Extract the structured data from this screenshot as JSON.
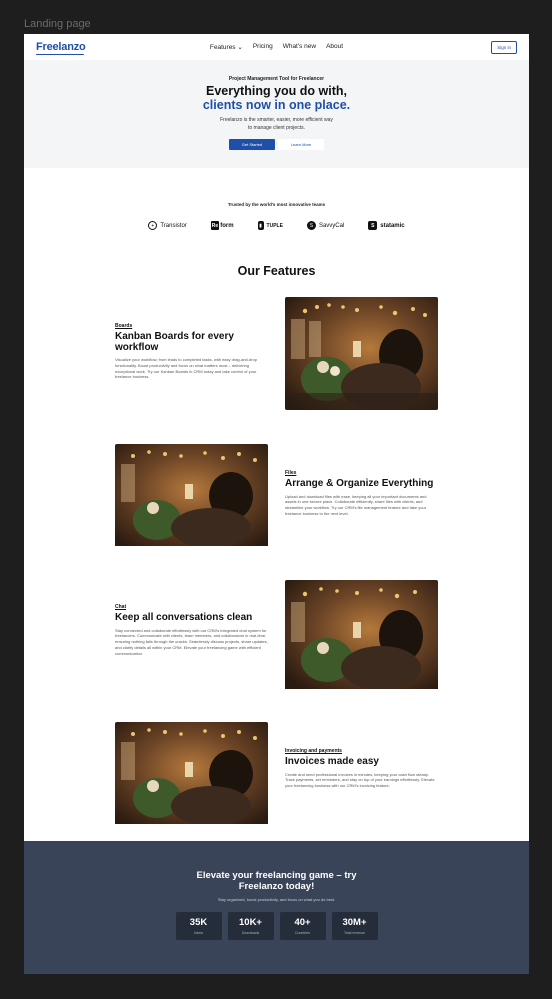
{
  "frame_label": "Landing page",
  "nav": {
    "logo": "Freelanzo",
    "links": [
      "Features ⌄",
      "Pricing",
      "What's new",
      "About"
    ],
    "signin": "Sign in"
  },
  "hero": {
    "eyebrow": "Project Management Tool for Freelancer",
    "title": "Everything you do with,",
    "title_accent": "clients now in one place.",
    "subtitle_line1": "Freelanzo is the smarter, easier, more efficient way",
    "subtitle_line2": "to manage client projects.",
    "primary_button": "Get Started",
    "secondary_button": "Learn More"
  },
  "trusted": {
    "title": "Trusted by the world's most innovative teams",
    "logos": [
      {
        "name": "Transistor",
        "icon": "circle-plus-icon",
        "mark": "+"
      },
      {
        "name": "form",
        "prefix": "Re",
        "icon": "reform-icon"
      },
      {
        "name": "TUPLE",
        "icon": "tuple-icon",
        "mark": "▮"
      },
      {
        "name": "SavvyCal",
        "icon": "savvycal-icon",
        "mark": "S"
      },
      {
        "name": "statamic",
        "icon": "statamic-icon",
        "mark": "S"
      }
    ]
  },
  "features": {
    "title": "Our Features",
    "items": [
      {
        "tag": "Boards",
        "title": "Kanban Boards for every workflow",
        "body": "Visualize your workflow, from leads to completed tasks, with easy drag-and-drop functionality. Boost productivity and focus on what matters most – delivering exceptional work. Try our Kanban Boards in CRM today and take control of your freelance business."
      },
      {
        "tag": "Files",
        "title": "Arrange & Organize Everything",
        "body": "Upload and download files with ease, keeping all your important documents and assets in one secure place. Collaborate efficiently, share files with clients, and streamline your workflow. Try our CRM's file management feature and take your freelance business to the next level."
      },
      {
        "tag": "Chat",
        "title": "Keep all conversations clean",
        "body": "Stay connected and collaborate effortlessly with our CRM's integrated chat system for freelancers. Communicate with clients, team members, and collaborators in real-time, ensuring nothing falls through the cracks. Seamlessly discuss projects, share updates, and clarify details all within your CRM. Elevate your freelancing game with efficient communication."
      },
      {
        "tag": "Invoicing and payments",
        "title": "Invoices made easy",
        "body": "Create and send professional invoices in minutes, keeping your cash flow steady. Track payments, set reminders, and stay on top of your earnings effortlessly. Elevate your freelancing business with our CRM's invoicing feature."
      }
    ]
  },
  "cta": {
    "title_line1": "Elevate your freelancing game – try",
    "title_line2": "Freelanzo today!",
    "subtitle": "Stay organized, boost productivity, and focus on what you do best.",
    "stats": [
      {
        "value": "35K",
        "label": "Users"
      },
      {
        "value": "10K+",
        "label": "Downloads"
      },
      {
        "value": "40+",
        "label": "Countries"
      },
      {
        "value": "30M+",
        "label": "Total revenue"
      }
    ]
  }
}
